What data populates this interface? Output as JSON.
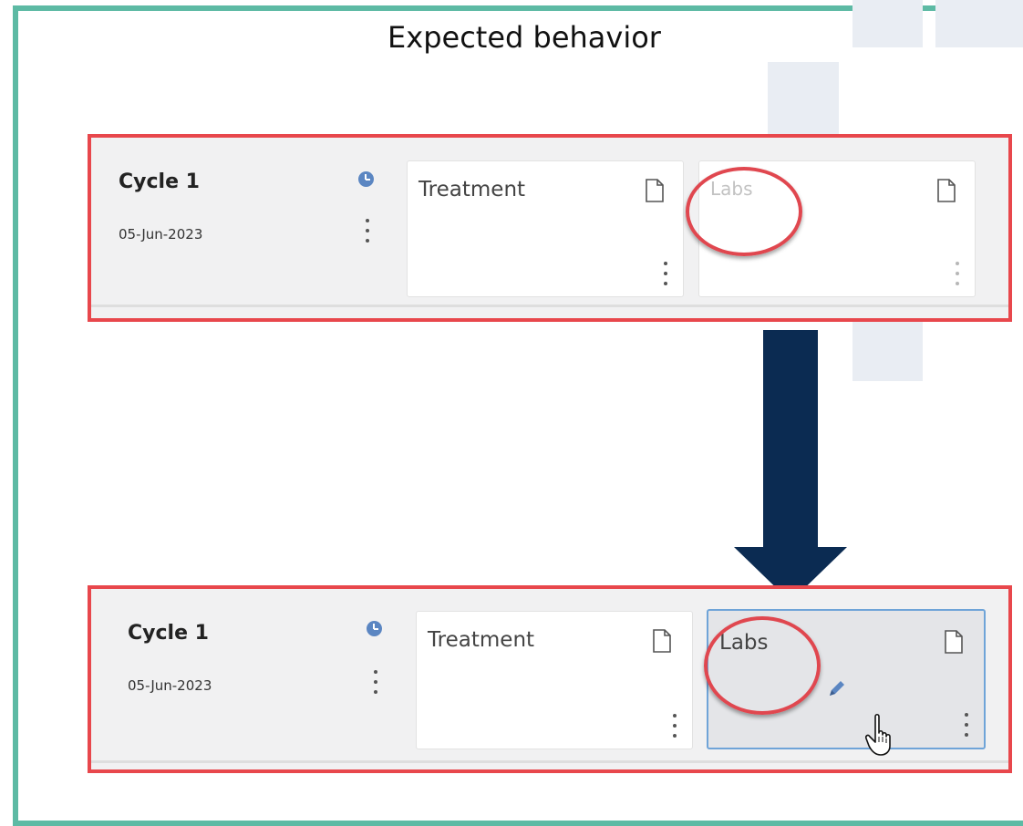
{
  "title": "Expected behavior",
  "before": {
    "cycle_name": "Cycle 1",
    "cycle_date": "05-Jun-2023",
    "cards": [
      {
        "label": "Treatment"
      },
      {
        "label": "Labs"
      }
    ]
  },
  "after": {
    "cycle_name": "Cycle 1",
    "cycle_date": "05-Jun-2023",
    "cards": [
      {
        "label": "Treatment"
      },
      {
        "label": "Labs"
      }
    ]
  },
  "colors": {
    "frame": "#5dbaa4",
    "highlight": "#e8474c",
    "arrow": "#0b2b52",
    "clock": "#5b86c2",
    "active_border": "#6fa4d8"
  },
  "icons": [
    "clock-icon",
    "kebab-menu-icon",
    "document-icon",
    "pencil-icon",
    "hand-cursor-icon",
    "down-arrow"
  ]
}
